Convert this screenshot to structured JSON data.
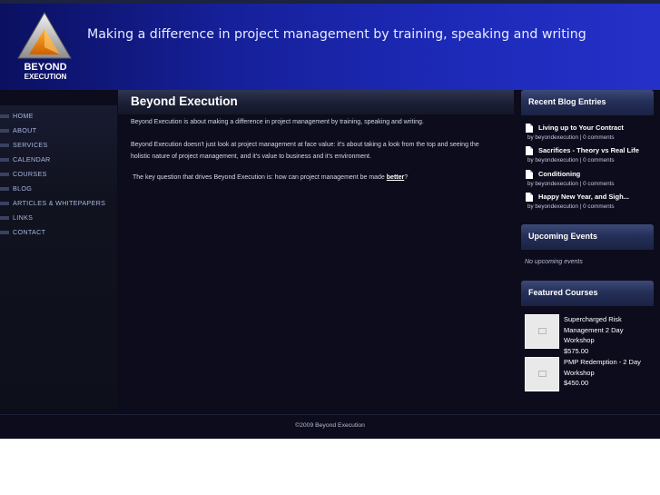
{
  "header": {
    "logo_text_1": "BEYOND",
    "logo_text_2": "EXECUTION",
    "tagline": "Making a difference in project management by training, speaking and writing"
  },
  "nav": {
    "items": [
      {
        "label": "HOME"
      },
      {
        "label": "ABOUT"
      },
      {
        "label": "SERVICES"
      },
      {
        "label": "CALENDAR"
      },
      {
        "label": "COURSES"
      },
      {
        "label": "BLOG"
      },
      {
        "label": "ARTICLES & WHITEPAPERS"
      },
      {
        "label": "LINKS"
      },
      {
        "label": "CONTACT"
      }
    ]
  },
  "main": {
    "title": "Beyond Execution",
    "p1": "Beyond Execution is about making a difference in project management by training, speaking and writing.",
    "p2": "Beyond Execution doesn't just look at project management at face value: it's about taking a look from the top and seeing the holistic nature of project management, and it's value to business and it's environment.",
    "p3_prefix": "The key question that drives Beyond Execution is: how can project management be made ",
    "p3_link": "better",
    "p3_suffix": "?"
  },
  "sidebar": {
    "blog_heading": "Recent Blog Entries",
    "blog_entries": [
      {
        "title": "Living up to Your Contract",
        "author": "beyondexecution",
        "comments": "0 comments"
      },
      {
        "title": "Sacrifices - Theory vs Real Life",
        "author": "beyondexecution",
        "comments": "0 comments"
      },
      {
        "title": "Conditioning",
        "author": "beyondexecution",
        "comments": "0 comments"
      },
      {
        "title": "Happy New Year, and Sigh...",
        "author": "beyondexecution",
        "comments": "0 comments"
      }
    ],
    "by_label": "by",
    "separator": "|",
    "events_heading": "Upcoming Events",
    "no_events": "No upcoming events",
    "courses_heading": "Featured Courses",
    "courses": [
      {
        "name": "Supercharged Risk Management 2 Day Workshop",
        "price": "$575.00"
      },
      {
        "name": "PMP Redemption - 2 Day Workshop",
        "price": "$450.00"
      }
    ]
  },
  "footer": {
    "copyright": "©2009 Beyond Execution"
  },
  "colors": {
    "header_blue": "#1d2ab8",
    "page_bg": "#0c0c1c",
    "nav_text": "#a9b6e0"
  }
}
